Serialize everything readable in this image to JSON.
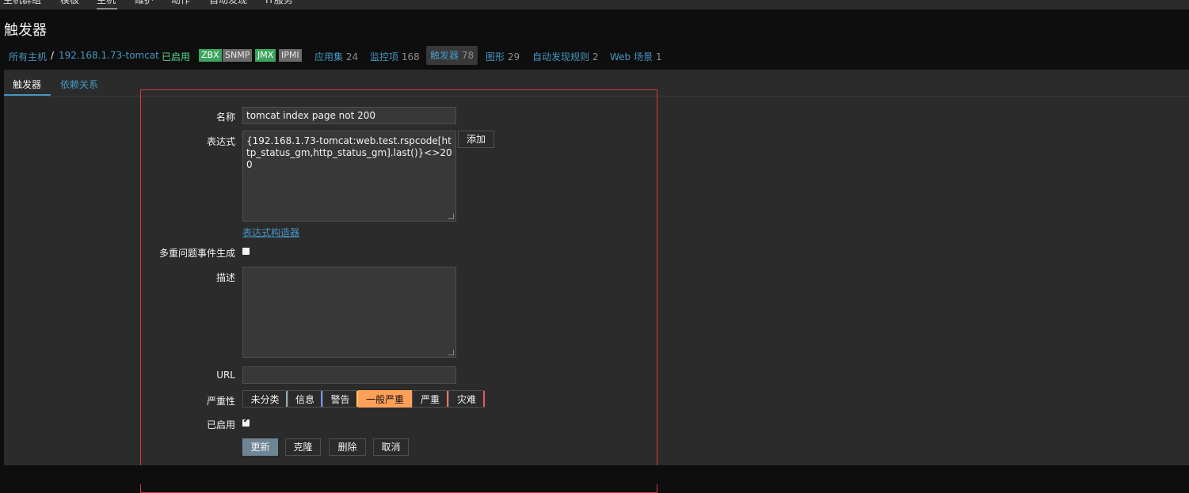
{
  "topnav": {
    "items": [
      "主机群组",
      "模板",
      "主机",
      "维护",
      "动作",
      "自动发现",
      "IT服务"
    ]
  },
  "page": {
    "title": "触发器"
  },
  "breadcrumb": {
    "all_hosts": "所有主机",
    "separator": "/",
    "host": "192.168.1.73-tomcat",
    "status": "已启用",
    "tags": [
      {
        "label": "ZBX",
        "active": true
      },
      {
        "label": "SNMP",
        "active": false
      },
      {
        "label": "JMX",
        "active": true
      },
      {
        "label": "IPMI",
        "active": false
      }
    ],
    "links": [
      {
        "label": "应用集",
        "count": "24"
      },
      {
        "label": "监控项",
        "count": "168"
      },
      {
        "label": "触发器",
        "count": "78"
      },
      {
        "label": "图形",
        "count": "29"
      },
      {
        "label": "自动发现规则",
        "count": "2"
      },
      {
        "label": "Web 场景",
        "count": "1"
      }
    ]
  },
  "tabs": {
    "trigger": "触发器",
    "dependencies": "依赖关系"
  },
  "form": {
    "name_label": "名称",
    "name_value": "tomcat index page not 200",
    "expression_label": "表达式",
    "expression_value": "{192.168.1.73-tomcat:web.test.rspcode[http_status_gm,http_status_gm].last()}<>200",
    "add_button": "添加",
    "expression_constructor": "表达式构造器",
    "multiple_events_label": "多重问题事件生成",
    "description_label": "描述",
    "description_value": "",
    "url_label": "URL",
    "url_value": "",
    "severity_label": "严重性",
    "severity_options": [
      "未分类",
      "信息",
      "警告",
      "一般严重",
      "严重",
      "灾难"
    ],
    "severity_selected": "一般严重",
    "enabled_label": "已启用",
    "buttons": {
      "update": "更新",
      "clone": "克隆",
      "delete": "删除",
      "cancel": "取消"
    }
  },
  "colors": {
    "accent": "#4796c4",
    "severity_average": "#ffa059",
    "severity_info": "#7499ff",
    "severity_warning": "#ffc859",
    "severity_high": "#e97659",
    "severity_disaster": "#e45959",
    "highlight_box": "#d9393b"
  }
}
